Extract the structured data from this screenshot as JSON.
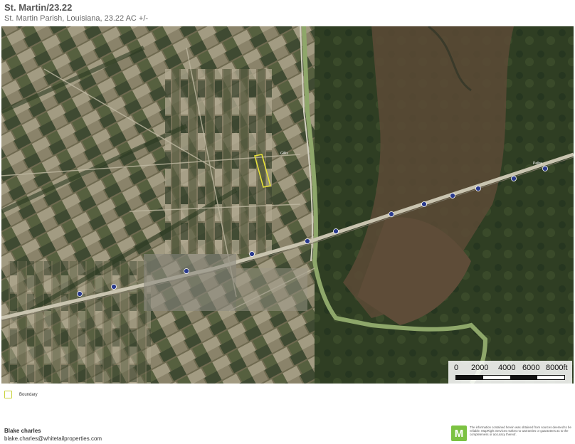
{
  "header": {
    "title": "St. Martin/23.22",
    "subtitle": "St. Martin Parish, Louisiana, 23.22 AC +/-"
  },
  "map": {
    "type": "satellite",
    "boundary_color": "#e8e23a",
    "highway_shield_color": "#2a3a8c",
    "road_labels": [
      "Pelba",
      "Gillis"
    ]
  },
  "scale_bar": {
    "labels": [
      "0",
      "2000",
      "4000",
      "6000",
      "8000ft"
    ]
  },
  "legend": {
    "items": [
      {
        "label": "Boundary",
        "color": "#c8d23a"
      }
    ]
  },
  "contact": {
    "name": "Blake charles",
    "email": "blake.charles@whitetailproperties.com"
  },
  "disclaimer": {
    "logo_letter": "M",
    "text": "The information contained herein was obtained from sources deemed to be reliable. MapRight Services makes no warranties or guarantees as to the completeness or accuracy thereof."
  }
}
